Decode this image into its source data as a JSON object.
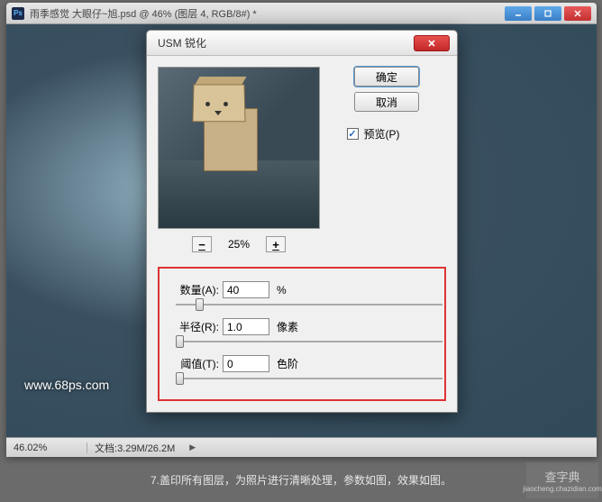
{
  "ps_window": {
    "icon_text": "Ps",
    "title": "雨季感觉  大眼仔~旭.psd @ 46% (图层 4, RGB/8#) *"
  },
  "statusbar": {
    "zoom": "46.02%",
    "docsize_label": "文档:",
    "docsize_value": "3.29M/26.2M",
    "arrow": "▶"
  },
  "watermark_left": "www.68ps.com",
  "dialog": {
    "title": "USM 锐化",
    "ok_label": "确定",
    "cancel_label": "取消",
    "preview_label": "预览(P)",
    "preview_checked": "✓",
    "zoom_minus": "−",
    "zoom_plus": "+",
    "zoom_pct": "25%",
    "params": {
      "amount": {
        "label": "数量(A):",
        "value": "40",
        "unit": "%"
      },
      "radius": {
        "label": "半径(R):",
        "value": "1.0",
        "unit": "像素"
      },
      "threshold": {
        "label": "阈值(T):",
        "value": "0",
        "unit": "色阶"
      }
    }
  },
  "caption": "7.盖印所有图层，为照片进行清晰处理，参数如图，效果如图。",
  "watermark_right": {
    "top": "查字典",
    "bottom": "jiaocheng.chazidian.com"
  }
}
